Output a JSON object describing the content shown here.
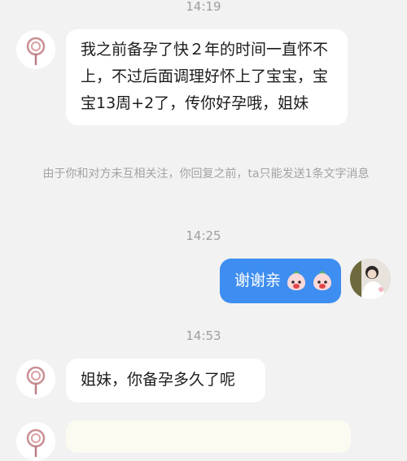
{
  "chat": {
    "timestamps": [
      "14:19",
      "14:25",
      "14:53"
    ],
    "messages": [
      {
        "sender": "other",
        "avatar_icon": "lollipop-avatar-icon",
        "text": "我之前备孕了快２年的时间一直怀不上，不过后面调理好怀上了宝宝，宝宝13周+2了，传你好孕哦，姐妹"
      },
      {
        "sender": "me",
        "avatar_icon": "user-photo-avatar",
        "text": "谢谢亲",
        "stickers": [
          "blessing-emoji-icon",
          "blessing-emoji-icon"
        ]
      },
      {
        "sender": "other",
        "avatar_icon": "lollipop-avatar-icon",
        "text": "姐妹，你备孕多久了呢"
      }
    ],
    "system_notice": "由于你和对方未互相关注，你回复之前，ta只能发送1条文字消息"
  },
  "colors": {
    "background": "#f2f2f2",
    "incoming_bubble": "#ffffff",
    "outgoing_bubble": "#3d8ef0",
    "muted_text": "#9e9e9e"
  }
}
